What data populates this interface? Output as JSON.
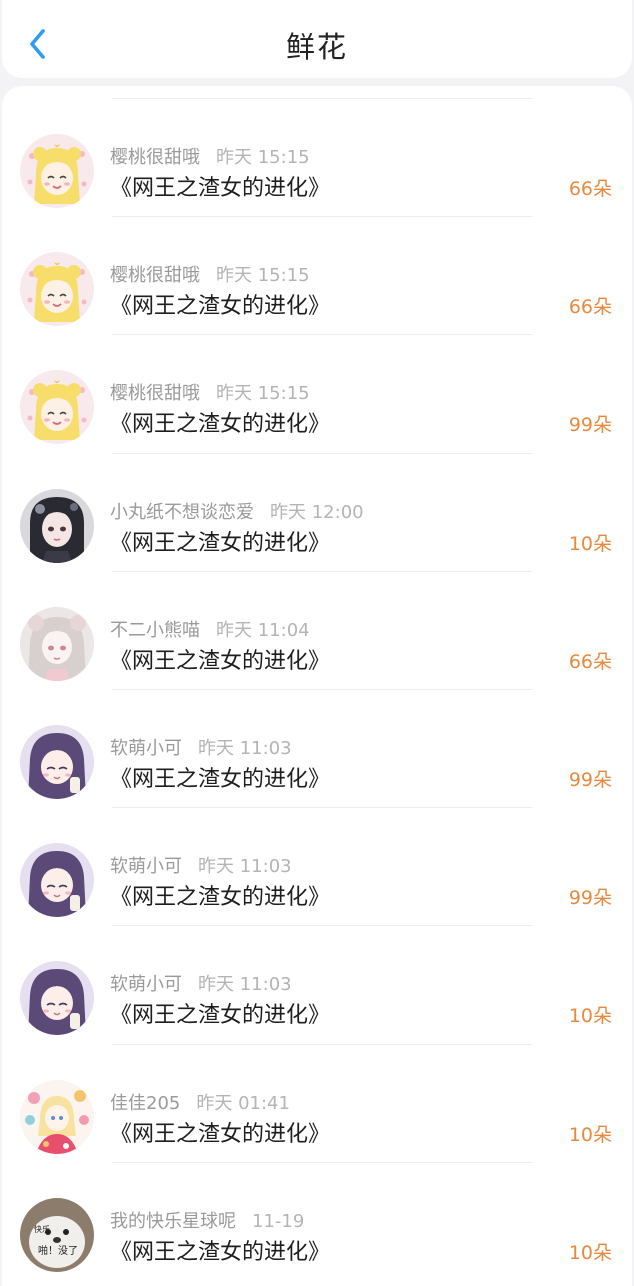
{
  "header": {
    "title": "鲜花"
  },
  "rows": [
    {
      "name": "樱桃很甜哦",
      "time": "昨天 15:15",
      "book": "《网王之渣女的进化》",
      "count": "66朵",
      "avatar": "sailor-avatar"
    },
    {
      "name": "樱桃很甜哦",
      "time": "昨天 15:15",
      "book": "《网王之渣女的进化》",
      "count": "66朵",
      "avatar": "sailor-avatar"
    },
    {
      "name": "樱桃很甜哦",
      "time": "昨天 15:15",
      "book": "《网王之渣女的进化》",
      "count": "99朵",
      "avatar": "sailor-avatar"
    },
    {
      "name": "小丸纸不想谈恋爱",
      "time": "昨天 12:00",
      "book": "《网王之渣女的进化》",
      "count": "10朵",
      "avatar": "dark-hair-avatar"
    },
    {
      "name": "不二小熊喵",
      "time": "昨天 11:04",
      "book": "《网王之渣女的进化》",
      "count": "66朵",
      "avatar": "pale-girl-avatar"
    },
    {
      "name": "软萌小可",
      "time": "昨天 11:03",
      "book": "《网王之渣女的进化》",
      "count": "99朵",
      "avatar": "purple-hair-avatar"
    },
    {
      "name": "软萌小可",
      "time": "昨天 11:03",
      "book": "《网王之渣女的进化》",
      "count": "99朵",
      "avatar": "purple-hair-avatar"
    },
    {
      "name": "软萌小可",
      "time": "昨天 11:03",
      "book": "《网王之渣女的进化》",
      "count": "10朵",
      "avatar": "purple-hair-avatar"
    },
    {
      "name": "佳佳205",
      "time": "昨天 01:41",
      "book": "《网王之渣女的进化》",
      "count": "10朵",
      "avatar": "flower-girl-avatar"
    },
    {
      "name": "我的快乐星球呢",
      "time": "11-19",
      "book": "《网王之渣女的进化》",
      "count": "10朵",
      "avatar": "seal-meme-avatar",
      "avatar_text": [
        "快乐",
        "啪！没了"
      ]
    }
  ],
  "colors": {
    "accent": "#2f9bf0",
    "count": "#e9893f"
  }
}
